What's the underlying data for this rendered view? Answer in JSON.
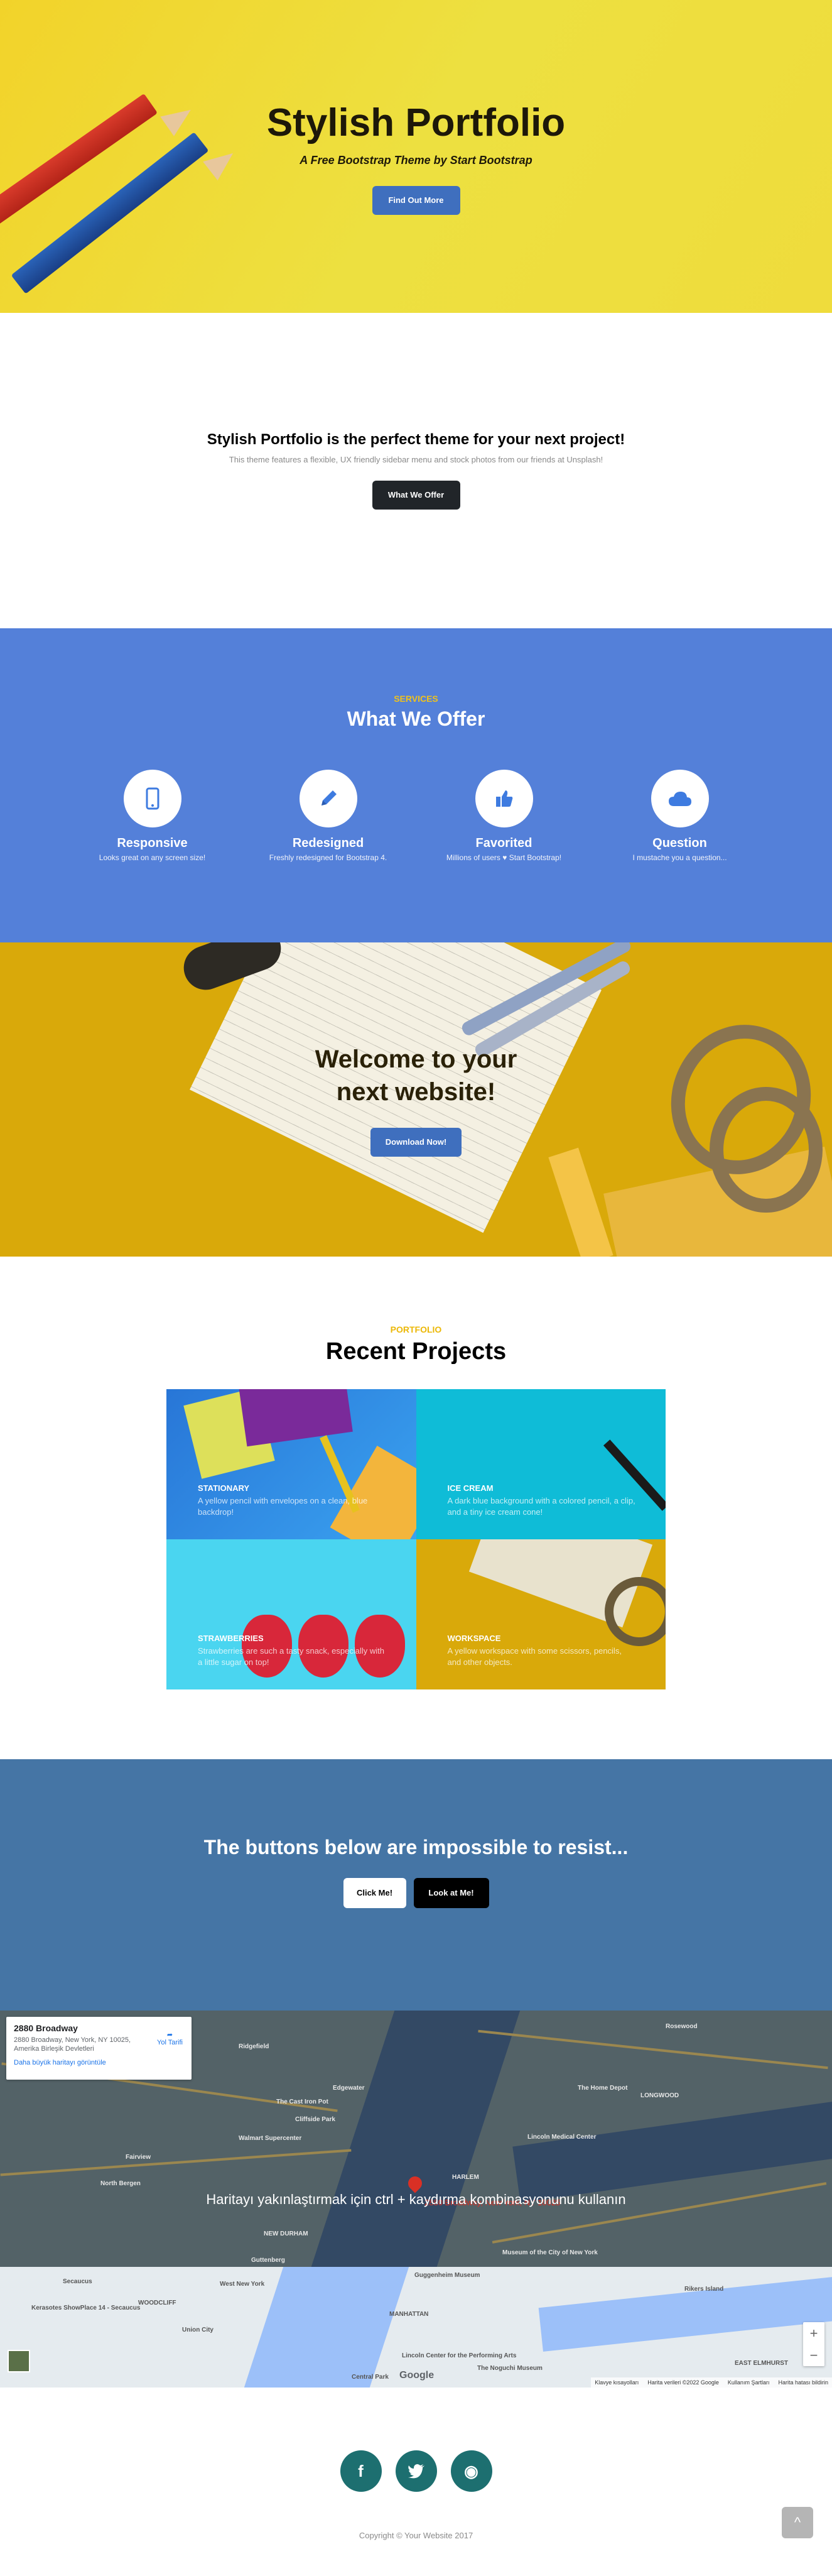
{
  "menu": {
    "icon": "hamburger-icon",
    "glyph": "≡"
  },
  "hero": {
    "title": "Stylish Portfolio",
    "subtitle": "A Free Bootstrap Theme by Start Bootstrap",
    "button": "Find Out More"
  },
  "about": {
    "title": "Stylish Portfolio is the perfect theme for your next project!",
    "lead": "This theme features a flexible, UX friendly sidebar menu and stock photos from our friends at Unsplash!",
    "button": "What We Offer"
  },
  "services": {
    "kicker": "SERVICES",
    "title": "What We Offer",
    "items": [
      {
        "name": "Responsive",
        "desc": "Looks great on any screen size!",
        "icon": "mobile-phone-icon"
      },
      {
        "name": "Redesigned",
        "desc": "Freshly redesigned for Bootstrap 4.",
        "icon": "pencil-icon"
      },
      {
        "name": "Favorited",
        "desc_before": "Millions of users ",
        "desc_heart": "♥",
        "desc_after": " Start Bootstrap!",
        "icon": "thumbs-up-icon"
      },
      {
        "name": "Question",
        "desc": "I mustache you a question...",
        "icon": "cloud-icon"
      }
    ]
  },
  "callout": {
    "title_line1": "Welcome to your",
    "title_line2": "next website!",
    "button": "Download Now!"
  },
  "portfolio": {
    "kicker": "PORTFOLIO",
    "title": "Recent Projects",
    "items": [
      {
        "title": "STATIONARY",
        "desc": "A yellow pencil with envelopes on a clean, blue backdrop!"
      },
      {
        "title": "ICE CREAM",
        "desc": "A dark blue background with a colored pencil, a clip, and a tiny ice cream cone!"
      },
      {
        "title": "STRAWBERRIES",
        "desc": "Strawberries are such a tasty snack, especially with a little sugar on top!"
      },
      {
        "title": "WORKSPACE",
        "desc": "A yellow workspace with some scissors, pencils, and other objects."
      }
    ]
  },
  "cta": {
    "title": "The buttons below are impossible to resist...",
    "button_primary": "Click Me!",
    "button_secondary": "Look at Me!"
  },
  "map": {
    "card_title": "2880 Broadway",
    "card_address": "2880 Broadway, New York, NY 10025, Amerika Birleşik Devletleri",
    "card_link": "Daha büyük haritayı görüntüle",
    "card_directions": "Yol Tarifi",
    "hint": "Haritayı yakınlaştırmak için ctrl + kaydırma kombinasyonunu kullanın",
    "pin_label": "2880 Broadway, New York, NY 10025",
    "zoom_in": "+",
    "zoom_out": "−",
    "logo": "Google",
    "footer": [
      "Klavye kısayolları",
      "Harita verileri ©2022 Google",
      "Kullanım Şartları",
      "Harita hatası bildirin"
    ],
    "labels": [
      "Ridgefield",
      "Edgewater",
      "Cliffside Park",
      "The Cast Iron Pot",
      "Fairview",
      "North Bergen",
      "Secaucus",
      "West New York",
      "Union City",
      "MANHATTAN",
      "HARLEM",
      "Guttenberg",
      "WOODCLIFF",
      "NEW DURHAM",
      "Guggenheim Museum",
      "Central Park",
      "The Noguchi Museum",
      "EAST ELMHURST",
      "Rikers Island",
      "LONGWOOD",
      "Rosewood",
      "Kerasotes ShowPlace 14 - Secaucus",
      "Walmart Supercenter",
      "The Home Depot",
      "Lincoln Medical Center",
      "Museum of the City of New York",
      "Lincoln Center for the Performing Arts"
    ]
  },
  "footer": {
    "social": [
      {
        "icon": "facebook-icon",
        "glyph": "f"
      },
      {
        "icon": "twitter-icon",
        "glyph": "t"
      },
      {
        "icon": "github-icon",
        "glyph": "◉"
      }
    ],
    "copyright": "Copyright © Your Website 2017",
    "scroll_top_glyph": "^"
  },
  "colors": {
    "hero_bg": "#EFDC3C",
    "services_bg": "#5480D9",
    "accent_kicker": "#ECB807",
    "cta_bg": "#4575A5",
    "social_btn": "#1D6F70",
    "primary_button": "#3F6FBE"
  }
}
